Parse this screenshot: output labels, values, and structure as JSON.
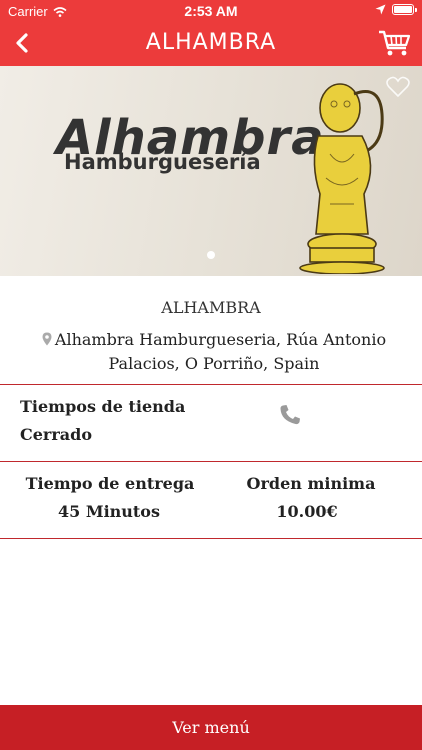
{
  "status_bar": {
    "carrier": "Carrier",
    "time": "2:53 AM"
  },
  "header": {
    "title": "ALHAMBRA",
    "back_icon": "chevron-left-icon",
    "cart_icon": "cart-icon"
  },
  "hero": {
    "brand_text": "Alhambra",
    "sub_text": "Hamburguesería",
    "favorite_icon": "heart-icon"
  },
  "store": {
    "name": "ALHAMBRA",
    "address": "Alhambra Hamburgueseria, Rúa Antonio Palacios, O Porriño, Spain"
  },
  "hours": {
    "label": "Tiempos de tienda",
    "status": "Cerrado"
  },
  "delivery": {
    "time_label": "Tiempo de entrega",
    "time_value": "45 Minutos",
    "min_order_label": "Orden minima",
    "min_order_value": "10.00€"
  },
  "footer": {
    "menu_button": "Ver menú"
  },
  "colors": {
    "header_red": "#ec3b3b",
    "button_red": "#c61f25",
    "divider_red": "#c0282d"
  }
}
